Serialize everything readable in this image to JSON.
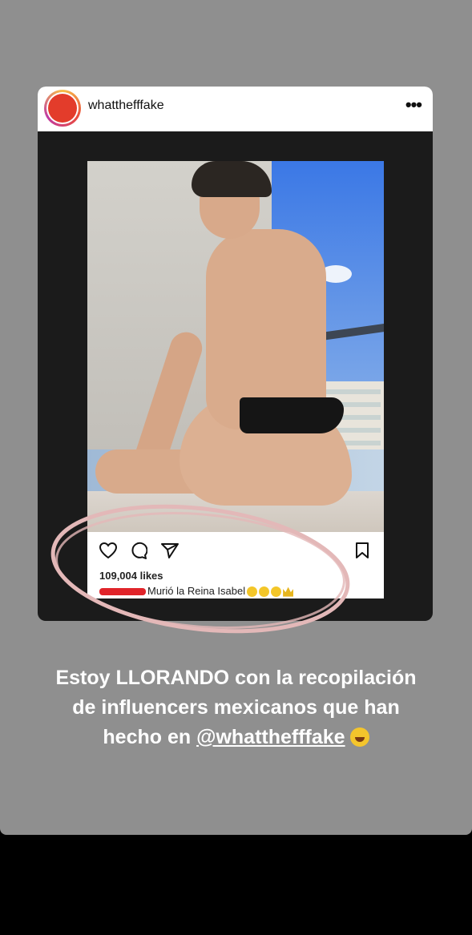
{
  "post": {
    "username": "whatthefffake",
    "more_label": "•••",
    "likes": "109,004 likes",
    "caption_text": "Murió la Reina Isabel"
  },
  "icons": {
    "heart": "heart-icon",
    "comment": "comment-icon",
    "share": "send-icon",
    "save": "bookmark-icon"
  },
  "story": {
    "line1": "Estoy LLORANDO con la recopilación",
    "line2": "de influencers mexicanos que han",
    "line3_prefix": "hecho en ",
    "mention": "@whatthefffake"
  },
  "colors": {
    "story_bg": "#8f8f8f",
    "annotation": "#e3b8b8",
    "redaction": "#e0242a"
  }
}
